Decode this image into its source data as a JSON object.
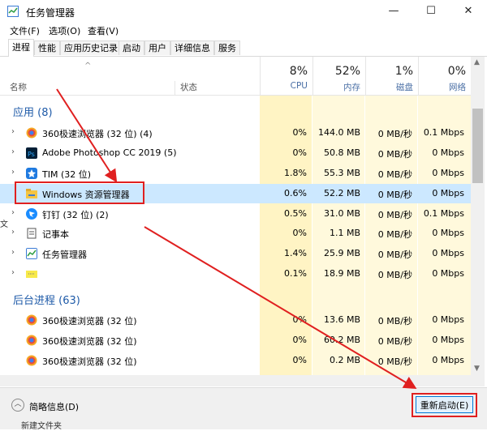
{
  "window": {
    "title": "任务管理器",
    "min": "—",
    "max": "☐",
    "close": "✕"
  },
  "menu": [
    "文件(F)",
    "选项(O)",
    "查看(V)"
  ],
  "tabs": [
    "进程",
    "性能",
    "应用历史记录",
    "启动",
    "用户",
    "详细信息",
    "服务"
  ],
  "header": {
    "name": "名称",
    "status": "状态",
    "sort": "^",
    "cpu": {
      "pct": "8%",
      "label": "CPU"
    },
    "mem": {
      "pct": "52%",
      "label": "内存"
    },
    "disk": {
      "pct": "1%",
      "label": "磁盘"
    },
    "net": {
      "pct": "0%",
      "label": "网络"
    }
  },
  "groups": {
    "apps": "应用 (8)",
    "bg": "后台进程 (63)"
  },
  "rows": [
    {
      "name": "360极速浏览器 (32 位) (4)",
      "cpu": "0%",
      "mem": "144.0 MB",
      "disk": "0 MB/秒",
      "net": "0.1 Mbps",
      "icon": "browser-360-icon"
    },
    {
      "name": "Adobe Photoshop CC 2019 (5)",
      "cpu": "0%",
      "mem": "50.8 MB",
      "disk": "0 MB/秒",
      "net": "0 Mbps",
      "icon": "photoshop-icon"
    },
    {
      "name": "TIM (32 位)",
      "cpu": "1.8%",
      "mem": "55.3 MB",
      "disk": "0 MB/秒",
      "net": "0 Mbps",
      "icon": "tim-icon"
    },
    {
      "name": "Windows 资源管理器",
      "cpu": "0.6%",
      "mem": "52.2 MB",
      "disk": "0 MB/秒",
      "net": "0 Mbps",
      "icon": "folder-icon"
    },
    {
      "name": "钉钉 (32 位) (2)",
      "cpu": "0.5%",
      "mem": "31.0 MB",
      "disk": "0 MB/秒",
      "net": "0.1 Mbps",
      "icon": "dingtalk-icon"
    },
    {
      "name": "记事本",
      "cpu": "0%",
      "mem": "1.1 MB",
      "disk": "0 MB/秒",
      "net": "0 Mbps",
      "icon": "notepad-icon"
    },
    {
      "name": "任务管理器",
      "cpu": "1.4%",
      "mem": "25.9 MB",
      "disk": "0 MB/秒",
      "net": "0 Mbps",
      "icon": "taskmgr-icon"
    },
    {
      "name": "",
      "cpu": "0.1%",
      "mem": "18.9 MB",
      "disk": "0 MB/秒",
      "net": "0 Mbps",
      "icon": "app-icon"
    }
  ],
  "bgrows": [
    {
      "name": "360极速浏览器 (32 位)",
      "cpu": "0%",
      "mem": "13.6 MB",
      "disk": "0 MB/秒",
      "net": "0 Mbps"
    },
    {
      "name": "360极速浏览器 (32 位)",
      "cpu": "0%",
      "mem": "60.2 MB",
      "disk": "0 MB/秒",
      "net": "0 Mbps"
    },
    {
      "name": "360极速浏览器 (32 位)",
      "cpu": "0%",
      "mem": "0.2 MB",
      "disk": "0 MB/秒",
      "net": "0 Mbps"
    }
  ],
  "footer": {
    "fewer": "简略信息(D)",
    "restart": "重新启动(E)"
  },
  "edge": {
    "left": "文",
    "bottom": "新建文件夹"
  },
  "colors": {
    "accent": "#1e5aa8",
    "highlight": "#e02020",
    "selection": "#cce8ff"
  }
}
